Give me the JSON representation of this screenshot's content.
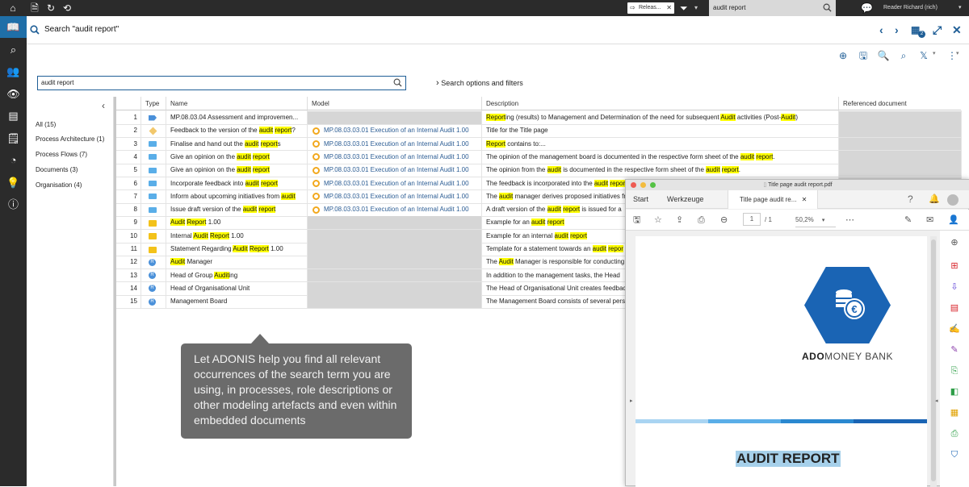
{
  "topbar": {
    "release_label": "Releas...",
    "search_value": "audit report",
    "user_label": "Reader Richard (rich)"
  },
  "header": {
    "title": "Search \"audit report\"",
    "badge_count": "2"
  },
  "search": {
    "value": "audit report",
    "options_label": "Search options and filters"
  },
  "categories": [
    {
      "label": "All (15)"
    },
    {
      "label": "Process Architecture (1)"
    },
    {
      "label": "Process Flows (7)"
    },
    {
      "label": "Documents (3)"
    },
    {
      "label": "Organisation (4)"
    }
  ],
  "table": {
    "columns": [
      "Type",
      "Name",
      "Model",
      "Description",
      "Referenced document"
    ],
    "rows": [
      {
        "n": "1",
        "type": "flow",
        "name": [
          {
            "t": "MP.08.03.04 Assessment and improvemen..."
          }
        ],
        "model": "",
        "desc": [
          {
            "t": "Report",
            "h": true
          },
          {
            "t": "ing (results) to Management and Determination of the need for subsequent "
          },
          {
            "t": "Audit",
            "h": true
          },
          {
            "t": " activities (Post-"
          },
          {
            "t": "Audit",
            "h": true
          },
          {
            "t": ")"
          }
        ]
      },
      {
        "n": "2",
        "type": "diamond",
        "name": [
          {
            "t": "Feedback to the version of the "
          },
          {
            "t": "audit",
            "h": true
          },
          {
            "t": " "
          },
          {
            "t": "report",
            "h": true
          },
          {
            "t": "?"
          }
        ],
        "model": "MP.08.03.03.01 Execution of an Internal Audit 1.00",
        "desc": [
          {
            "t": "Title for the "
          },
          {
            "t": "Title page",
            "h": false
          }
        ]
      },
      {
        "n": "3",
        "type": "task",
        "name": [
          {
            "t": "Finalise and hand out the "
          },
          {
            "t": "audit",
            "h": true
          },
          {
            "t": " "
          },
          {
            "t": "report",
            "h": true
          },
          {
            "t": "s"
          }
        ],
        "model": "MP.08.03.03.01 Execution of an Internal Audit 1.00",
        "desc": [
          {
            "t": "Report",
            "h": true
          },
          {
            "t": " contains to:..."
          }
        ]
      },
      {
        "n": "4",
        "type": "task",
        "name": [
          {
            "t": "Give an opinion on the "
          },
          {
            "t": "audit",
            "h": true
          },
          {
            "t": " "
          },
          {
            "t": "report",
            "h": true
          }
        ],
        "model": "MP.08.03.03.01 Execution of an Internal Audit 1.00",
        "desc": [
          {
            "t": "The opinion of the management board is documented in the respective form sheet of the "
          },
          {
            "t": "audit",
            "h": true
          },
          {
            "t": " "
          },
          {
            "t": "report",
            "h": true
          },
          {
            "t": "."
          }
        ]
      },
      {
        "n": "5",
        "type": "task",
        "name": [
          {
            "t": "Give an opinion on the "
          },
          {
            "t": "audit",
            "h": true
          },
          {
            "t": " "
          },
          {
            "t": "report",
            "h": true
          }
        ],
        "model": "MP.08.03.03.01 Execution of an Internal Audit 1.00",
        "desc": [
          {
            "t": "The opinion from the "
          },
          {
            "t": "audit",
            "h": true
          },
          {
            "t": " is documented in the respective form sheet of the "
          },
          {
            "t": "audit",
            "h": true
          },
          {
            "t": " "
          },
          {
            "t": "report",
            "h": true
          },
          {
            "t": "."
          }
        ]
      },
      {
        "n": "6",
        "type": "task",
        "name": [
          {
            "t": "Incorporate feedback into "
          },
          {
            "t": "audit",
            "h": true
          },
          {
            "t": " "
          },
          {
            "t": "report",
            "h": true
          }
        ],
        "model": "MP.08.03.03.01 Execution of an Internal Audit 1.00",
        "desc": [
          {
            "t": "The feedback is incorporated into the "
          },
          {
            "t": "audit",
            "h": true
          },
          {
            "t": " "
          },
          {
            "t": "report",
            "h": true
          }
        ]
      },
      {
        "n": "7",
        "type": "task",
        "name": [
          {
            "t": "Inform about upcoming initiatives from "
          },
          {
            "t": "audit",
            "h": true
          }
        ],
        "model": "MP.08.03.03.01 Execution of an Internal Audit 1.00",
        "desc": [
          {
            "t": "The "
          },
          {
            "t": "audit",
            "h": true
          },
          {
            "t": " manager derives proposed initiatives fr"
          }
        ]
      },
      {
        "n": "8",
        "type": "task",
        "name": [
          {
            "t": "Issue draft version of the "
          },
          {
            "t": "audit",
            "h": true
          },
          {
            "t": " "
          },
          {
            "t": "report",
            "h": true
          }
        ],
        "model": "MP.08.03.03.01 Execution of an Internal Audit 1.00",
        "desc": [
          {
            "t": "A draft version of the "
          },
          {
            "t": "audit",
            "h": true
          },
          {
            "t": " "
          },
          {
            "t": "report",
            "h": true
          },
          {
            "t": " is issued for a"
          }
        ]
      },
      {
        "n": "9",
        "type": "doc",
        "name": [
          {
            "t": "Audit",
            "h": true
          },
          {
            "t": " "
          },
          {
            "t": "Report",
            "h": true
          },
          {
            "t": " 1.00"
          }
        ],
        "model": "",
        "desc": [
          {
            "t": "Example for an "
          },
          {
            "t": "audit",
            "h": true
          },
          {
            "t": " "
          },
          {
            "t": "report",
            "h": true
          }
        ]
      },
      {
        "n": "10",
        "type": "doc",
        "name": [
          {
            "t": "Internal "
          },
          {
            "t": "Audit",
            "h": true
          },
          {
            "t": " "
          },
          {
            "t": "Report",
            "h": true
          },
          {
            "t": " 1.00"
          }
        ],
        "model": "",
        "desc": [
          {
            "t": "Example for an internal "
          },
          {
            "t": "audit",
            "h": true
          },
          {
            "t": " "
          },
          {
            "t": "report",
            "h": true
          }
        ]
      },
      {
        "n": "11",
        "type": "doc",
        "name": [
          {
            "t": "Statement Regarding "
          },
          {
            "t": "Audit",
            "h": true
          },
          {
            "t": " "
          },
          {
            "t": "Report",
            "h": true
          },
          {
            "t": " 1.00"
          }
        ],
        "model": "",
        "desc": [
          {
            "t": "Template for a statement towards an "
          },
          {
            "t": "audit",
            "h": true
          },
          {
            "t": " "
          },
          {
            "t": "repor",
            "h": true
          }
        ]
      },
      {
        "n": "12",
        "type": "role",
        "name": [
          {
            "t": "Audit",
            "h": true
          },
          {
            "t": " Manager"
          }
        ],
        "model": "",
        "desc": [
          {
            "t": "The "
          },
          {
            "t": "Audit",
            "h": true
          },
          {
            "t": " Manager is responsible for conducting"
          }
        ]
      },
      {
        "n": "13",
        "type": "role",
        "name": [
          {
            "t": "Head of Group "
          },
          {
            "t": "Audit",
            "h": true
          },
          {
            "t": "ing"
          }
        ],
        "model": "",
        "desc": [
          {
            "t": "In addition to the management tasks, the Head"
          }
        ]
      },
      {
        "n": "14",
        "type": "role",
        "name": [
          {
            "t": "Head of Organisational Unit"
          }
        ],
        "model": "",
        "desc": [
          {
            "t": "The Head of Organisational Unit creates feedbac"
          }
        ]
      },
      {
        "n": "15",
        "type": "role",
        "name": [
          {
            "t": "Management Board"
          }
        ],
        "model": "",
        "desc": [
          {
            "t": "The Management Board consists of several pers"
          }
        ]
      }
    ]
  },
  "tooltip": {
    "text": "Let ADONIS help you find all relevant occurrences of the search term you are using, in processes, role descriptions or other modeling artefacts and even within embedded documents"
  },
  "pdf": {
    "window_title": "Title page audit report.pdf",
    "tab_start": "Start",
    "tab_tools": "Werkzeuge",
    "tab_doc": "Title page audit re...",
    "page_current": "1",
    "page_total": "/ 1",
    "zoom": "50,2%",
    "bank_bold": "ADO",
    "bank_rest": "MONEY BANK",
    "doc_title": "AUDIT REPORT"
  },
  "colors": {
    "accent": "#1f5e96",
    "highlight": "#ffff00",
    "sidebar": "#2b2b2b",
    "logo_blue": "#1a64b4"
  }
}
